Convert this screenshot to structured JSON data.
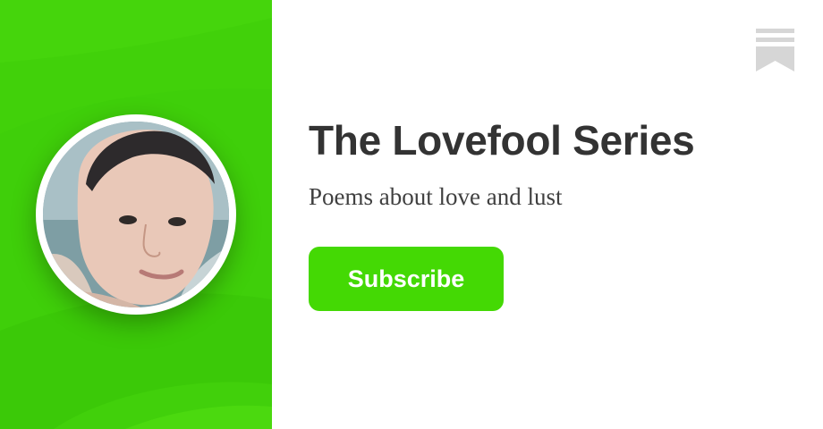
{
  "publication": {
    "title": "The Lovefool Series",
    "description": "Poems about love and lust"
  },
  "actions": {
    "subscribe_label": "Subscribe"
  },
  "icons": {
    "brand": "bookmark-icon",
    "avatar": "author-avatar"
  },
  "colors": {
    "panel_green": "#3fcf0a",
    "button_green": "#44d904",
    "title_text": "#333333",
    "bookmark_gray": "#d6d6d6"
  }
}
